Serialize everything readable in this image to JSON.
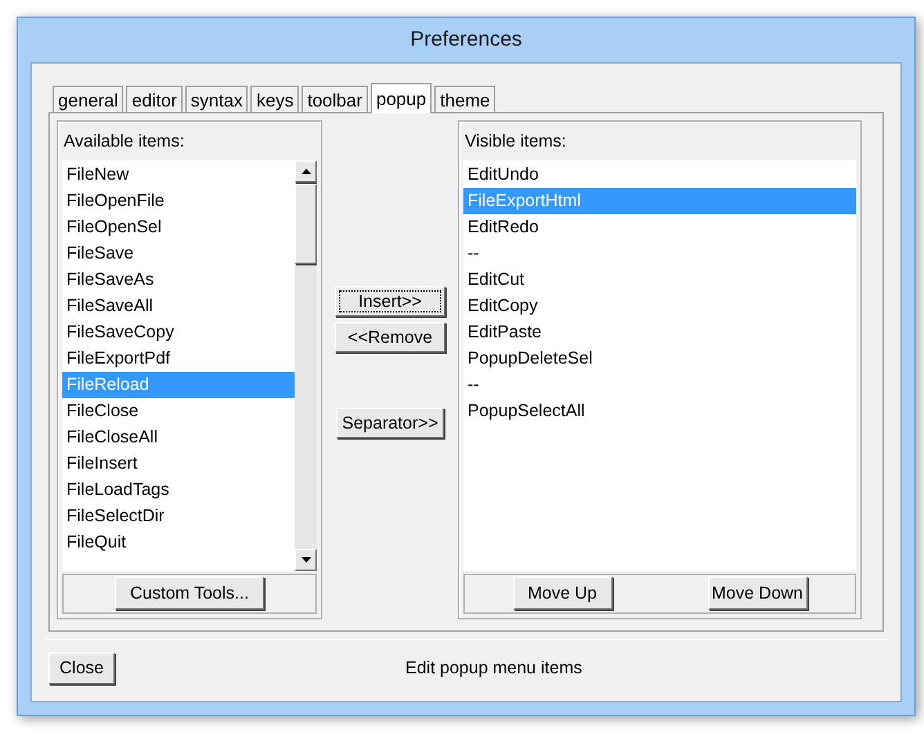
{
  "window": {
    "title": "Preferences"
  },
  "tabs": [
    {
      "label": "general",
      "selected": false
    },
    {
      "label": "editor",
      "selected": false
    },
    {
      "label": "syntax",
      "selected": false
    },
    {
      "label": "keys",
      "selected": false
    },
    {
      "label": "toolbar",
      "selected": false
    },
    {
      "label": "popup",
      "selected": true
    },
    {
      "label": "theme",
      "selected": false
    }
  ],
  "available": {
    "label": "Available items:",
    "items": [
      {
        "label": "FileNew",
        "selected": false
      },
      {
        "label": "FileOpenFile",
        "selected": false
      },
      {
        "label": "FileOpenSel",
        "selected": false
      },
      {
        "label": "FileSave",
        "selected": false
      },
      {
        "label": "FileSaveAs",
        "selected": false
      },
      {
        "label": "FileSaveAll",
        "selected": false
      },
      {
        "label": "FileSaveCopy",
        "selected": false
      },
      {
        "label": "FileExportPdf",
        "selected": false
      },
      {
        "label": "FileReload",
        "selected": true
      },
      {
        "label": "FileClose",
        "selected": false
      },
      {
        "label": "FileCloseAll",
        "selected": false
      },
      {
        "label": "FileInsert",
        "selected": false
      },
      {
        "label": "FileLoadTags",
        "selected": false
      },
      {
        "label": "FileSelectDir",
        "selected": false
      },
      {
        "label": "FileQuit",
        "selected": false
      }
    ],
    "button": "Custom Tools..."
  },
  "middle_buttons": [
    {
      "label": "Insert>>",
      "focused": true
    },
    {
      "label": "<<Remove",
      "focused": false
    },
    {
      "label": "Separator>>",
      "focused": false
    }
  ],
  "visible": {
    "label": "Visible items:",
    "items": [
      {
        "label": "EditUndo",
        "selected": false
      },
      {
        "label": "FileExportHtml",
        "selected": true
      },
      {
        "label": "EditRedo",
        "selected": false
      },
      {
        "label": "--",
        "selected": false
      },
      {
        "label": "EditCut",
        "selected": false
      },
      {
        "label": "EditCopy",
        "selected": false
      },
      {
        "label": "EditPaste",
        "selected": false
      },
      {
        "label": "PopupDeleteSel",
        "selected": false
      },
      {
        "label": "--",
        "selected": false
      },
      {
        "label": "PopupSelectAll",
        "selected": false
      }
    ],
    "buttons": [
      "Move Up",
      "Move Down"
    ]
  },
  "close_button": "Close",
  "status": "Edit popup menu items"
}
